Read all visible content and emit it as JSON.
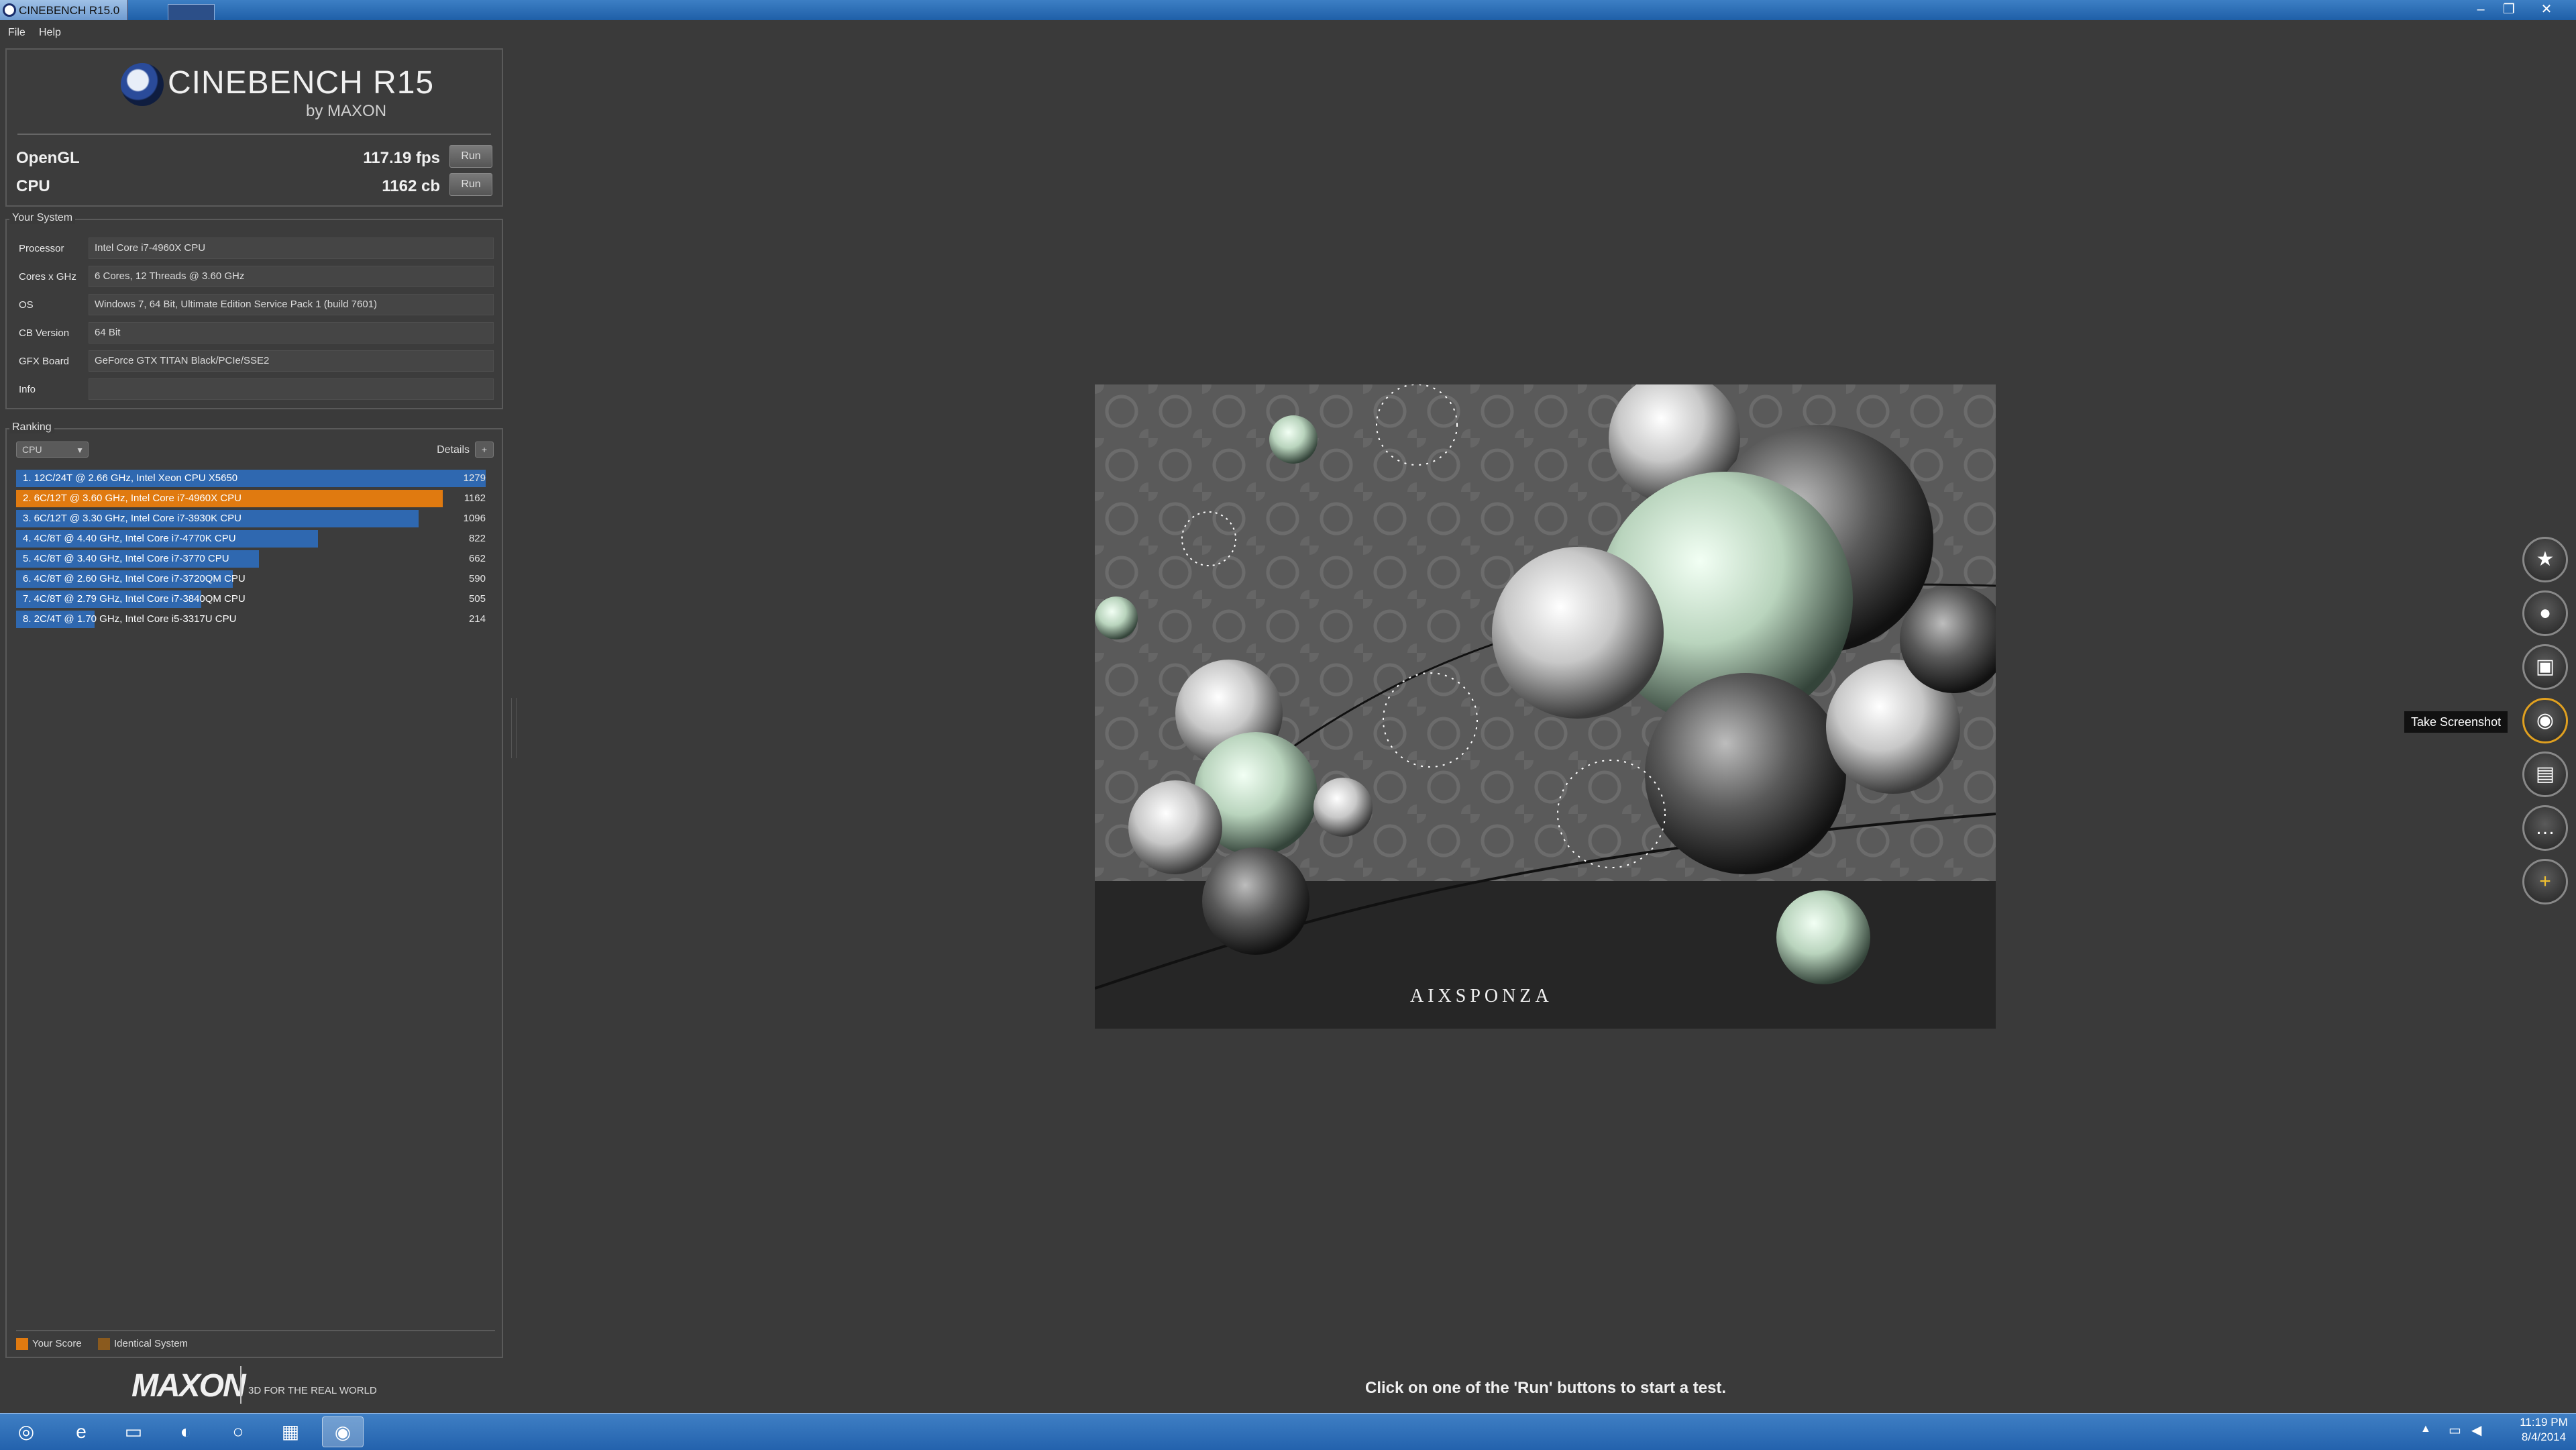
{
  "window": {
    "title": "CINEBENCH R15.0",
    "minimize": "–",
    "restore": "❐",
    "close": "✕"
  },
  "menu": {
    "file": "File",
    "help": "Help"
  },
  "logo": {
    "title": "CINEBENCH R15",
    "subtitle": "by MAXON"
  },
  "benchmarks": {
    "opengl": {
      "label": "OpenGL",
      "score": "117.19 fps",
      "run": "Run"
    },
    "cpu": {
      "label": "CPU",
      "score": "1162 cb",
      "run": "Run"
    }
  },
  "system": {
    "title": "Your System",
    "rows": [
      {
        "label": "Processor",
        "value": "Intel Core i7-4960X CPU"
      },
      {
        "label": "Cores x GHz",
        "value": "6 Cores, 12 Threads @ 3.60 GHz"
      },
      {
        "label": "OS",
        "value": "Windows 7, 64 Bit, Ultimate Edition Service Pack 1 (build 7601)"
      },
      {
        "label": "CB Version",
        "value": "64 Bit"
      },
      {
        "label": "GFX Board",
        "value": "GeForce GTX TITAN Black/PCIe/SSE2"
      },
      {
        "label": "Info",
        "value": ""
      }
    ]
  },
  "ranking": {
    "title": "Ranking",
    "select_value": "CPU",
    "details_label": "Details",
    "details_btn": "+",
    "entries": [
      {
        "label": "1. 12C/24T @ 2.66 GHz, Intel Xeon CPU X5650",
        "score": "1279",
        "value": 1279,
        "highlight": false
      },
      {
        "label": "2. 6C/12T @ 3.60 GHz,  Intel Core i7-4960X CPU",
        "score": "1162",
        "value": 1162,
        "highlight": true
      },
      {
        "label": "3. 6C/12T @ 3.30 GHz,  Intel Core i7-3930K CPU",
        "score": "1096",
        "value": 1096,
        "highlight": false
      },
      {
        "label": "4. 4C/8T @ 4.40 GHz, Intel Core i7-4770K CPU",
        "score": "822",
        "value": 822,
        "highlight": false
      },
      {
        "label": "5. 4C/8T @ 3.40 GHz,  Intel Core i7-3770 CPU",
        "score": "662",
        "value": 662,
        "highlight": false
      },
      {
        "label": "6. 4C/8T @ 2.60 GHz, Intel Core i7-3720QM CPU",
        "score": "590",
        "value": 590,
        "highlight": false
      },
      {
        "label": "7. 4C/8T @ 2.79 GHz,  Intel Core i7-3840QM CPU",
        "score": "505",
        "value": 505,
        "highlight": false
      },
      {
        "label": "8. 2C/4T @ 1.70 GHz,  Intel Core i5-3317U CPU",
        "score": "214",
        "value": 214,
        "highlight": false
      }
    ],
    "legend": {
      "your_score": "Your Score",
      "identical": "Identical System"
    },
    "colors": {
      "bar": "#2f68b0",
      "your_score": "#e07a10",
      "identical": "#8a5a1e"
    }
  },
  "footer": {
    "maxon": "MAXON",
    "tagline": "3D FOR THE REAL WORLD"
  },
  "render": {
    "watermark": "AIXSPONZA"
  },
  "status": "Click on one of the 'Run' buttons to start a test.",
  "overlay": {
    "tooltip": "Take Screenshot",
    "icons": [
      "badge-icon",
      "user-icon",
      "twitch-icon",
      "camera-icon",
      "stream-icon",
      "chat-icon",
      "plus-icon"
    ]
  },
  "taskbar": {
    "apps": [
      "start-orb-icon",
      "internet-explorer-icon",
      "explorer-folder-icon",
      "firefox-icon",
      "steam-icon",
      "paint-icon",
      "cinebench-icon"
    ],
    "time": "11:19 PM",
    "date": "8/4/2014"
  }
}
